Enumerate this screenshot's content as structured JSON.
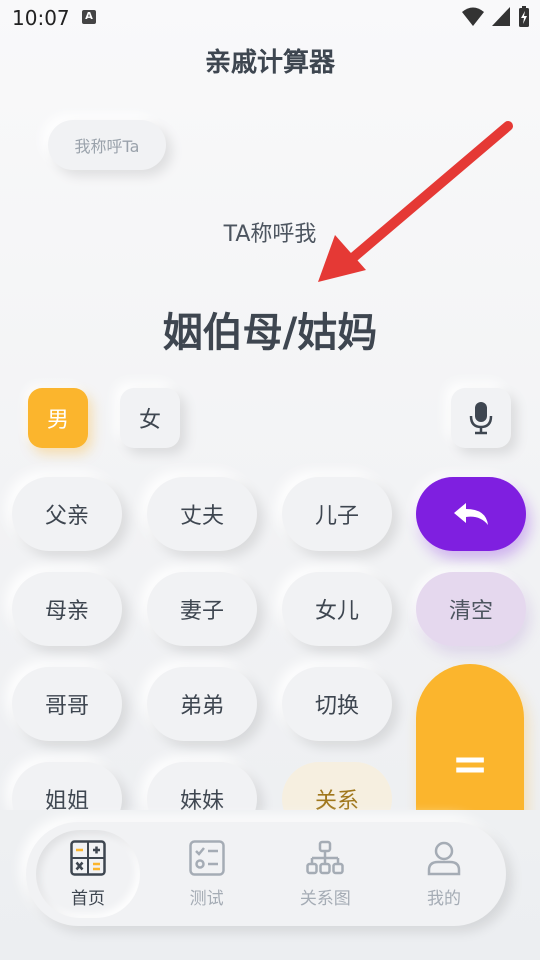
{
  "status": {
    "time": "10:07",
    "badge": "A"
  },
  "app_title": "亲戚计算器",
  "mode_toggle": "我称呼Ta",
  "tagline": "TA称呼我",
  "result": "姻伯母/姑妈",
  "gender": {
    "male": "男",
    "female": "女"
  },
  "keys": {
    "father": "父亲",
    "husband": "丈夫",
    "son": "儿子",
    "mother": "母亲",
    "wife": "妻子",
    "daughter": "女儿",
    "clear": "清空",
    "elder_brother": "哥哥",
    "younger_brother": "弟弟",
    "switch": "切换",
    "elder_sister": "姐姐",
    "younger_sister": "妹妹",
    "relation": "关系",
    "equals": "="
  },
  "tabs": [
    {
      "label": "首页",
      "icon": "calculator-icon"
    },
    {
      "label": "测试",
      "icon": "checklist-icon"
    },
    {
      "label": "关系图",
      "icon": "tree-icon"
    },
    {
      "label": "我的",
      "icon": "person-icon"
    }
  ],
  "colors": {
    "accent_yellow": "#fbb52d",
    "accent_purple": "#7f1fe0",
    "arrow_red": "#e53935",
    "text": "#3e4650"
  }
}
